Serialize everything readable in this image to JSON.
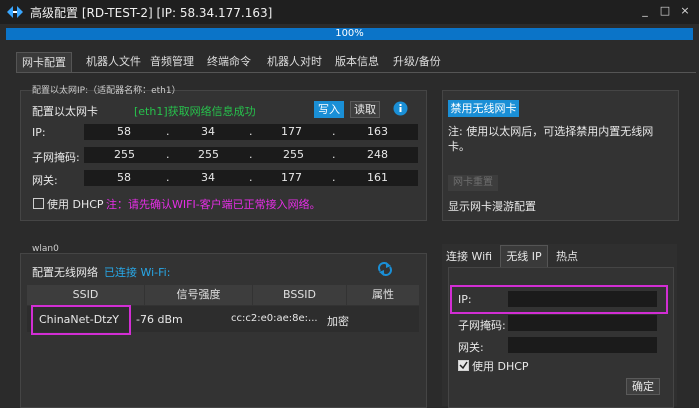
{
  "window": {
    "title": "高级配置  [RD-TEST-2] [IP: 58.34.177.163]",
    "controls": [
      "_",
      "□",
      "×"
    ]
  },
  "progress": {
    "value": 1.0,
    "label": "100%"
  },
  "tabs": [
    "网卡配置",
    "机器人文件",
    "音频管理",
    "终端命令",
    "机器人对时",
    "版本信息",
    "升级/备份"
  ],
  "ethernet": {
    "group_label": "配置以太网IP:（适配器名称：eth1）",
    "config_label": "配置以太网卡",
    "status": "[eth1]获取网络信息成功",
    "write_button": "写入",
    "read_button": "读取",
    "ip_label": "IP:",
    "ip": [
      "58",
      "34",
      "177",
      "163"
    ],
    "mask_label": "子网掩码:",
    "mask": [
      "255",
      "255",
      "255",
      "248"
    ],
    "gateway_label": "网关:",
    "gateway": [
      "58",
      "34",
      "177",
      "161"
    ],
    "dhcp_label": "使用 DHCP",
    "dhcp_checked": false,
    "note": "注：请先确认WIFI-客户端已正常接入网络。"
  },
  "wireless_disable": {
    "button": "禁用无线网卡",
    "note": "注: 使用以太网后，可选择禁用内置无线网卡。",
    "restore_button": "网卡重置",
    "roaming_link": "显示网卡漫游配置"
  },
  "wlan": {
    "group_label": "wlan0",
    "config_label": "配置无线网络",
    "connected_label": "已连接 Wi-Fi:",
    "columns": [
      "SSID",
      "信号强度",
      "BSSID",
      "属性"
    ],
    "rows": [
      {
        "ssid": "ChinaNet-DtzY",
        "signal": "-76 dBm",
        "bssid": "cc:c2:e0:ae:8e:...",
        "attr": "加密"
      }
    ]
  },
  "wifi_panel": {
    "tabs": [
      "连接 Wifi",
      "无线 IP",
      "热点"
    ],
    "active_tab": "无线 IP",
    "ip_label": "IP:",
    "mask_label": "子网掩码:",
    "gateway_label": "网关:",
    "dhcp_label": "使用 DHCP",
    "dhcp_checked": true,
    "confirm_button": "确定"
  },
  "colors": {
    "accent": "#1a8fd6",
    "success": "#27c24c",
    "warning": "#e62ee6",
    "highlight": "#d22ed4"
  }
}
